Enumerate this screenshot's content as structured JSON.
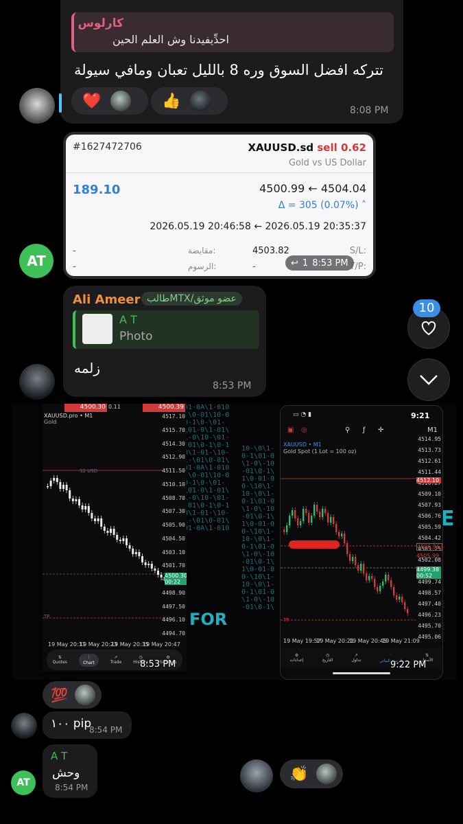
{
  "msg1": {
    "reply_author": "كارلوس",
    "reply_text": "احدِّيفيدنا وش العلم الحين",
    "text": "تتركه افضل السوق وره 8 بالليل تعبان ومافي سيولة",
    "time": "8:08 PM",
    "reactions": [
      "❤️",
      "👍"
    ]
  },
  "trade": {
    "ticket": "#1627472706",
    "symbol": "XAUUSD.sd",
    "side_label": "sell 0.62",
    "description": "Gold vs US Dollar",
    "profit": "189.10",
    "prices": "4500.99 ← 4504.04",
    "delta": "Δ = 305 (0.07%)",
    "times": "2026.05.19 20:46:58 ← 2026.05.19 20:35:37",
    "sl_label": "S/L:",
    "sl_value": "-",
    "swap_label": "مقايضة:",
    "swap_value": "4503.82",
    "tp_label": "T/P:",
    "tp_value": "-",
    "fees_label": "الرسوم:",
    "fees_value": "-",
    "left_dash1": "-",
    "left_dash2": "-",
    "reply_count": "1",
    "time": "8:53 PM"
  },
  "avatar_at_label": "AT",
  "msg2": {
    "author": "Ali Ameer",
    "badge": "طالبMTX/عضو موثق",
    "reply_author": "A T",
    "reply_type": "Photo",
    "text": "زلمه",
    "time": "8:53 PM"
  },
  "side_buttons": {
    "badge_count": "10"
  },
  "chart_left": {
    "symbol": "XAUUSD.pro • M1",
    "sub": "Gold",
    "top_left_price": "4500.30",
    "top_center": "0.11",
    "top_right_price": "4500.39",
    "s2_label": "S2 USD",
    "tp_label": "TP",
    "y_ticks": [
      "4517.10",
      "4515.70",
      "4514.30",
      "4512.90",
      "4511.50",
      "4510.10",
      "4508.70",
      "4507.30",
      "4505.90",
      "4504.50",
      "4503.10",
      "4501.70",
      "4500.30",
      "4498.90",
      "4497.50",
      "4496.10",
      "4494.70"
    ],
    "current_price": "4500.30",
    "countdown": "00:22",
    "x_ticks": [
      "19 May 20:11",
      "19 May 20:23",
      "19 May 20:35",
      "19 May 20:47"
    ],
    "tabs": [
      "Quotes",
      "Chart",
      "Trade",
      "History",
      "Settings"
    ],
    "time": "8:53 PM"
  },
  "chart_right": {
    "clock": "9:21",
    "timeframe": "M1",
    "symbol": "XAUUSD • M1",
    "sub": "Gold Spot (1 Lot = 100 oz)",
    "y_ticks": [
      "4514.95",
      "4513.73",
      "4512.61",
      "4511.44",
      "4510.27",
      "4509.10",
      "4507.93",
      "4506.76",
      "4505.59",
      "4504.42",
      "4503.25",
      "4502.08",
      "4500.91",
      "4499.74",
      "4498.57",
      "4497.40",
      "4496.23",
      "4495.70",
      "4495.06"
    ],
    "red_price_top": "4512.10",
    "red_price_mid": "4506.96",
    "red_price_mid2": "4505.99",
    "current_price": "4499.38",
    "countdown": "00:52",
    "tp_label": "TP",
    "x_ticks": [
      "19 May 19:57",
      "19 May 20:21",
      "19 May 20:45",
      "19 May 21:09"
    ],
    "tabs": [
      "إعدادات",
      "التاريخ",
      "تداول",
      "الرسم البياني",
      "الأسعار"
    ],
    "time": "9:22 PM"
  },
  "msg3": {
    "reactions": [
      "💯"
    ]
  },
  "msg4": {
    "text": "١٠٠ pip",
    "time": "8:54 PM"
  },
  "msg5": {
    "author": "A T",
    "text": "وحش",
    "time": "8:54 PM"
  },
  "msg6": {
    "reactions": [
      "👏"
    ]
  },
  "colors": {
    "accent_blue": "#2e7fd8",
    "sell_red": "#d23a3a",
    "green_avatar": "#3fbf57",
    "author_orange": "#f0913a",
    "badge_green": "#7fd38a",
    "reply_pink": "#e0607e"
  }
}
